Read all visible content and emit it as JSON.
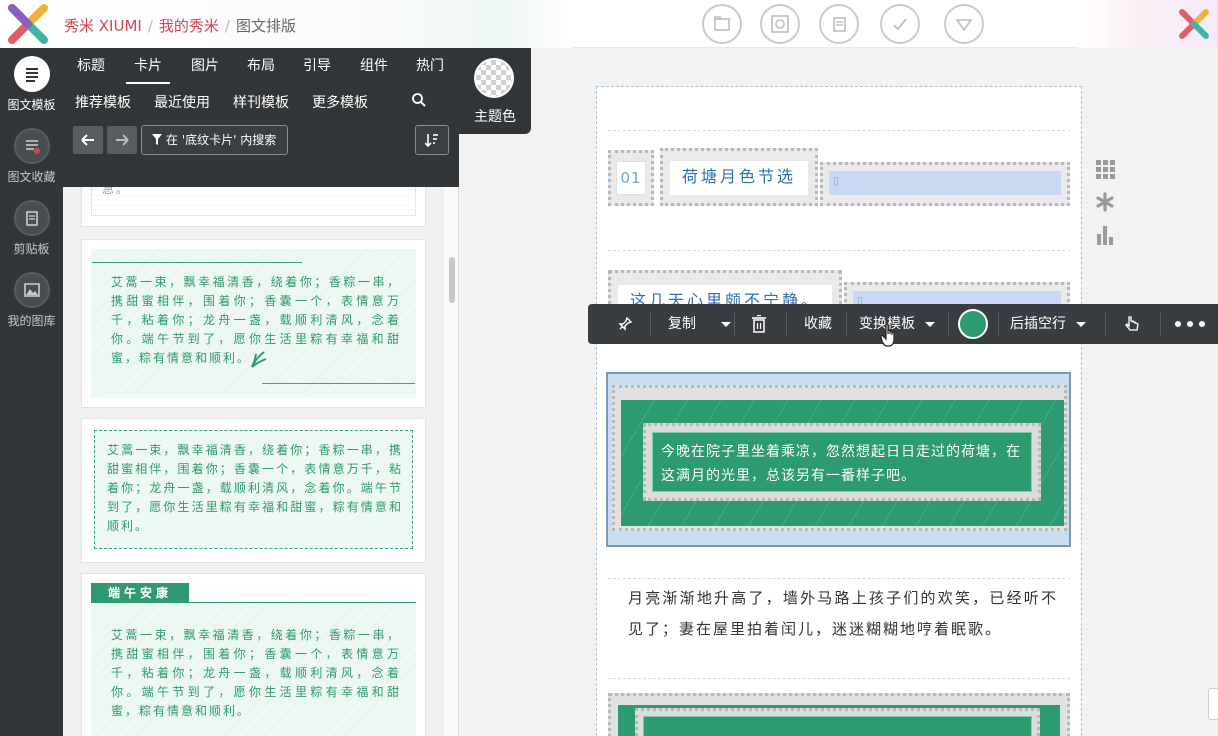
{
  "app": {
    "breadcrumb": [
      "秀米 XIUMI",
      "我的秀米",
      "图文排版"
    ],
    "accent": "#d24553"
  },
  "top_tools": [
    "folder-icon",
    "preview-icon",
    "copy-doc-icon",
    "check-icon",
    "download-icon"
  ],
  "left_nav": [
    {
      "label": "图文模板",
      "icon": "template-list-icon",
      "active": true
    },
    {
      "label": "图文收藏",
      "icon": "collection-icon",
      "active": false
    },
    {
      "label": "剪贴板",
      "icon": "clipboard-icon",
      "active": false
    },
    {
      "label": "我的图库",
      "icon": "gallery-icon",
      "active": false
    }
  ],
  "panel": {
    "categories": [
      "标题",
      "卡片",
      "图片",
      "布局",
      "引导",
      "组件",
      "热门"
    ],
    "active_category": "卡片",
    "subtabs": [
      "推荐模板",
      "最近使用",
      "样刊模板",
      "更多模板"
    ],
    "search_scope_label": "在 '底纹卡片' 内搜索",
    "cards": [
      {
        "text": "急。"
      },
      {
        "text": "艾蒿一束，飘幸福清香，绕着你；香粽一串，携甜蜜相伴，围着你；香囊一个，表情意万千，粘着你；龙舟一盏，载顺利清风，念着你。端午节到了，愿你生活里粽有幸福和甜蜜，粽有情意和顺利。"
      },
      {
        "text": "艾蒿一束，飘幸福清香，绕着你；香粽一串，携甜蜜相伴，围着你；香囊一个，表情意万千，粘着你；龙舟一盏，载顺利清风，念着你。端午节到了，愿你生活里粽有幸福和甜蜜，粽有情意和顺利。"
      },
      {
        "header": "端午安康",
        "text": "艾蒿一束，飘幸福清香，绕着你；香粽一串，携甜蜜相伴，围着你；香囊一个，表情意万千，粘着你；龙舟一盏，载顺利清风，念着你。端午节到了，愿你生活里粽有幸福和甜蜜，粽有情意和顺利。"
      }
    ],
    "green": "#2f9a70"
  },
  "theme": {
    "label": "主题色"
  },
  "toolbar": {
    "copy": "复制",
    "favorite": "收藏",
    "swap_template": "变换模板",
    "insert_blank_after": "后插空行",
    "selected_color": "#2f9a70"
  },
  "editor": {
    "title1_number": "01",
    "title1_text": "荷塘月色节选",
    "title2_text": "这几天心里颇不宁静。",
    "selected_block_text": "今晚在院子里坐着乘凉，忽然想起日日走过的荷塘，在这满月的光里，总该另有一番样子吧。",
    "paragraph": "月亮渐渐地升高了，墙外马路上孩子们的欢笑，已经听不见了；妻在屋里拍着闰儿，迷迷糊糊地哼着眠歌。"
  }
}
